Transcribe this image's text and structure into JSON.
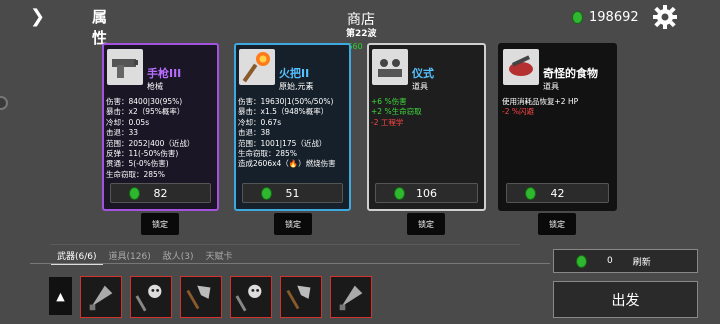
{
  "header": {
    "back_icon": "chevron-right-icon",
    "attributes_label": "属性",
    "shop_title": "商店",
    "wave_label": "第22波",
    "fps_label": "FPS60",
    "money": "198692",
    "settings_icon": "gear-icon"
  },
  "colors": {
    "weapon_border": "#a453e0",
    "weapon2_border": "#3ea9df",
    "item_border": "#cfcfcf",
    "gem_green": "#2fb82f",
    "stat_green": "#40d940",
    "stat_red": "#ff4545",
    "slot_border": "#d0342c"
  },
  "cards": [
    {
      "name": "手枪III",
      "type": "枪械",
      "icon": "pistol-icon",
      "price": "82",
      "lock_label": "锁定",
      "stats": [
        "伤害：8400|30(95%)",
        "暴击：x2（95%概率）",
        "冷却：0.05s",
        "击退：33",
        "范围：2052|400（近战）",
        "反弹：11(-50%伤害)",
        "贯通：5(-0%伤害)",
        "生命窃取：285%"
      ]
    },
    {
      "name": "火把II",
      "type": "原始,元素",
      "icon": "torch-icon",
      "price": "51",
      "lock_label": "锁定",
      "stats": [
        "伤害：19630|1(50%/50%)",
        "暴击：x1.5（948%概率）",
        "冷却：0.67s",
        "击退：38",
        "范围：1001|175（近战）",
        "生命窃取：285%",
        "造成2606x4（🔥）燃烧伤害"
      ]
    },
    {
      "name": "仪式",
      "type": "道具",
      "icon": "ritual-icon",
      "price": "106",
      "lock_label": "锁定",
      "stats": [
        "+6 %伤害",
        "+2 %生命窃取",
        "-2 工程学"
      ]
    },
    {
      "name": "奇怪的食物",
      "type": "道具",
      "icon": "strange-food-icon",
      "price": "42",
      "lock_label": "锁定",
      "stats": [
        "使用消耗品恢复+2 HP",
        "-2 %闪避"
      ]
    }
  ],
  "tabs": [
    {
      "label": "武器(6/6)",
      "active": true
    },
    {
      "label": "道具(126)",
      "active": false
    },
    {
      "label": "敌人(3)",
      "active": false
    },
    {
      "label": "天赋卡",
      "active": false
    }
  ],
  "inventory": {
    "scroll_up_icon": "triangle-up-icon",
    "slots": [
      "weapon-slot-1",
      "weapon-slot-2",
      "weapon-slot-3",
      "weapon-slot-4",
      "weapon-slot-5",
      "weapon-slot-6"
    ]
  },
  "refresh": {
    "cost": "0",
    "label": "刷新"
  },
  "go_button": "出发"
}
